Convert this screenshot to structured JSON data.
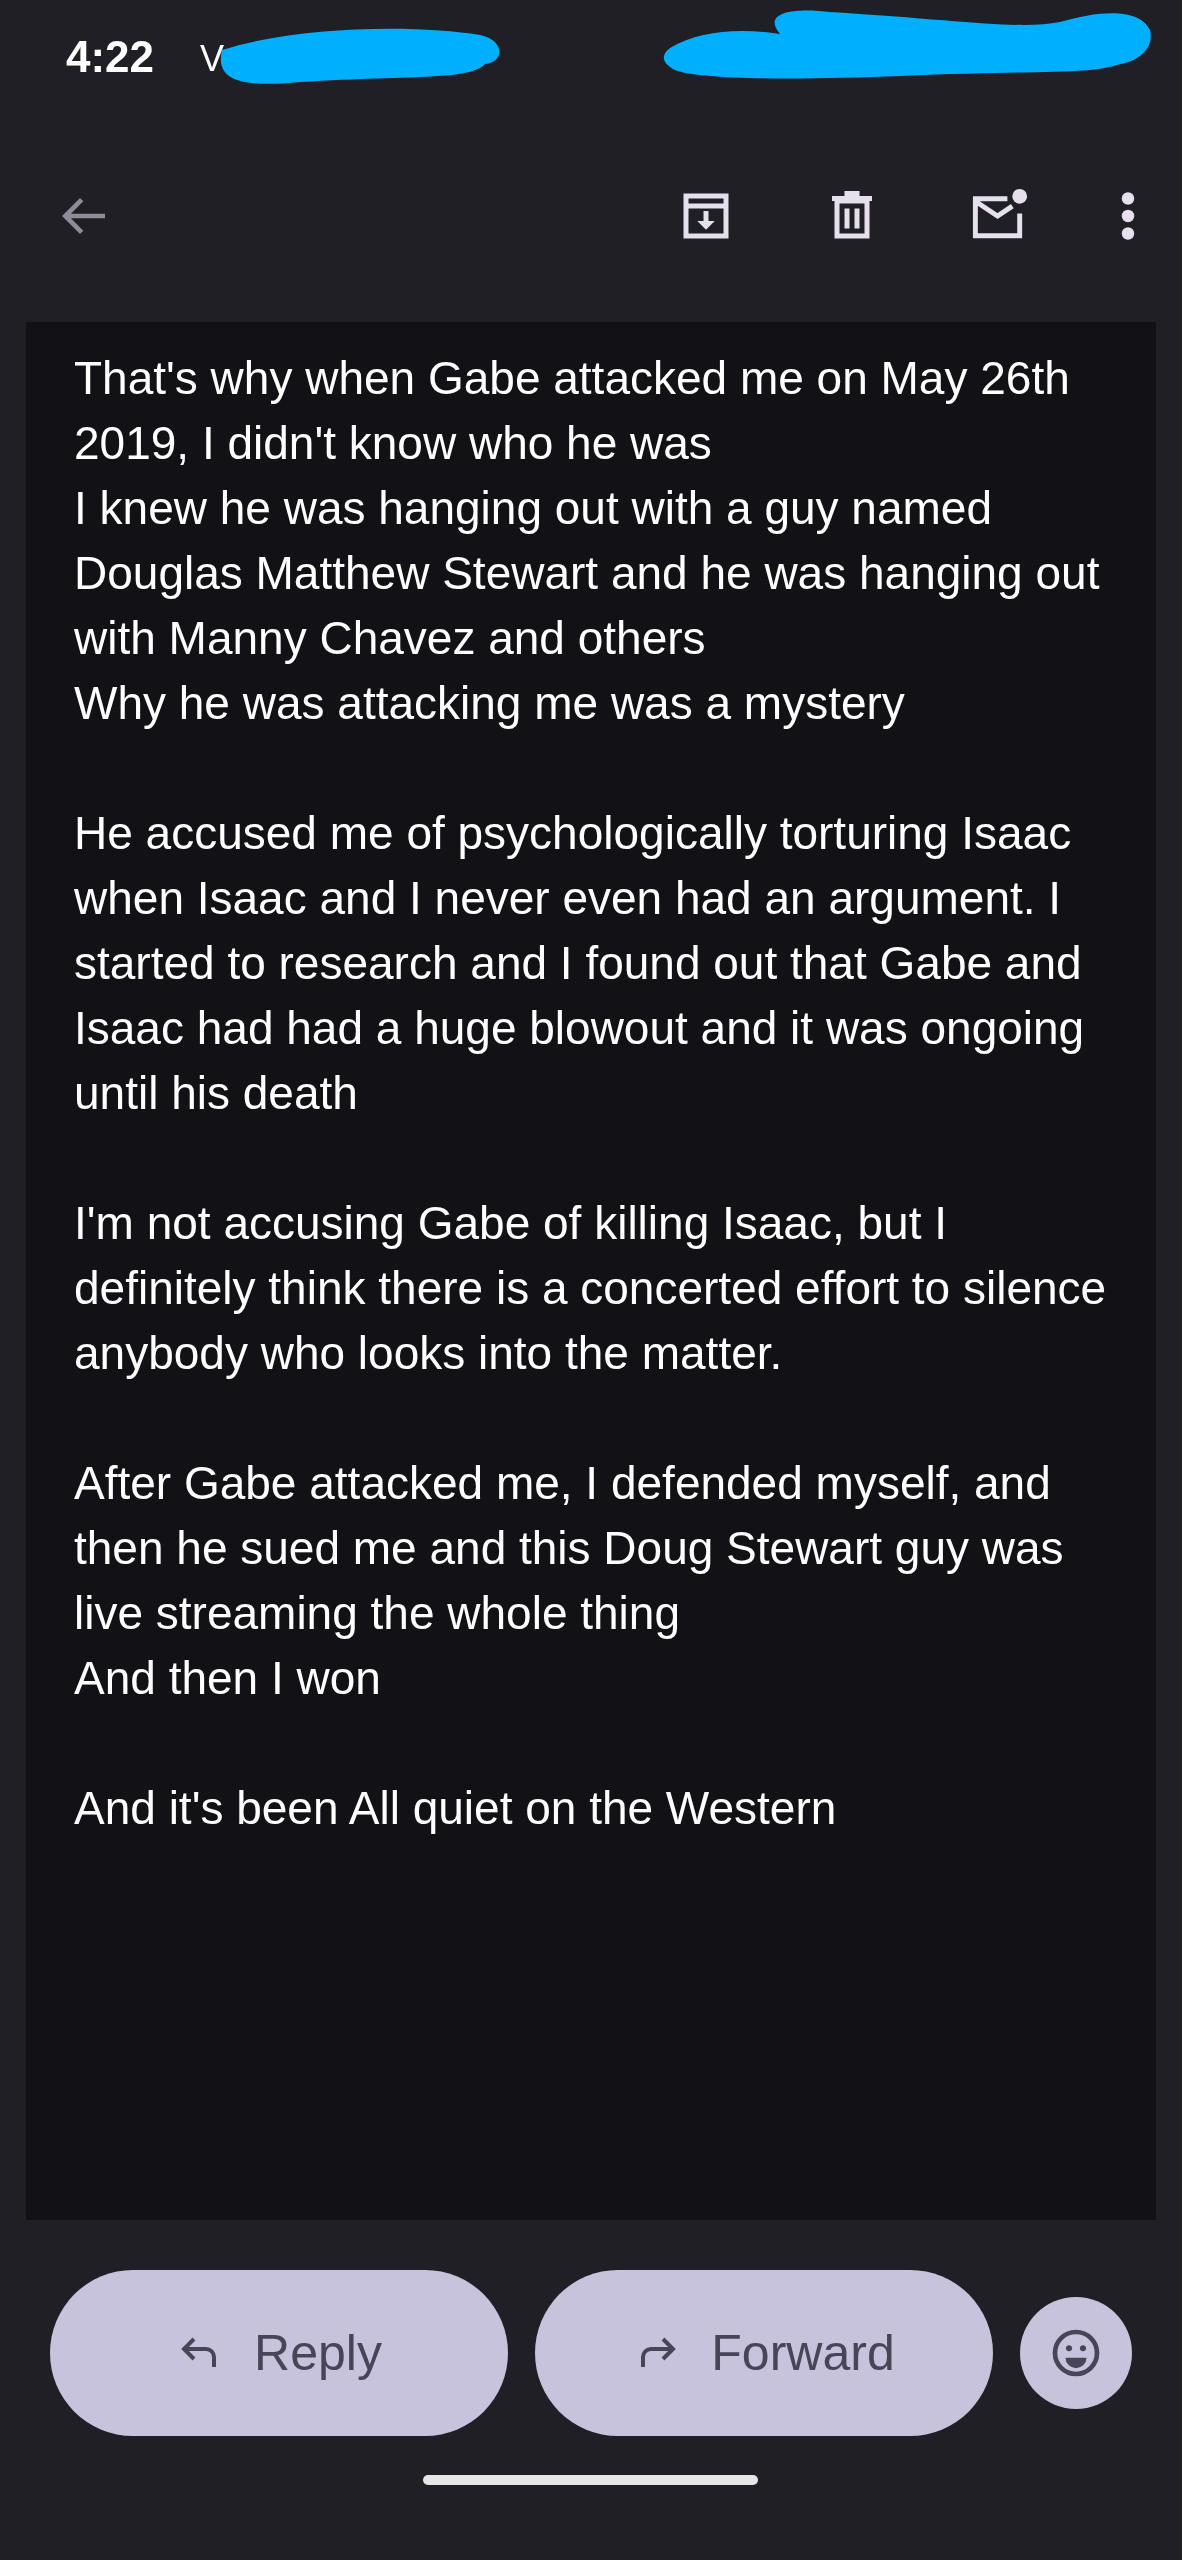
{
  "status_bar": {
    "time": "4:22",
    "carrier_fragment": "V"
  },
  "toolbar": {
    "actions": [
      {
        "kind": "archive"
      },
      {
        "kind": "delete"
      },
      {
        "kind": "mark_unread"
      },
      {
        "kind": "more"
      }
    ]
  },
  "message": {
    "paragraphs": [
      [
        "That's why when Gabe attacked me on May 26th 2019, I didn't know who he was",
        "I knew he was hanging out with a guy named Douglas Matthew Stewart and he was hanging out with Manny Chavez and others",
        "Why he was attacking me was a mystery"
      ],
      [
        "He accused me of psychologically torturing Isaac when Isaac and I never even had an argument. I started to research and I found out that Gabe and Isaac had had a huge blowout and it was ongoing until his death"
      ],
      [
        "I'm not accusing Gabe of killing Isaac, but I definitely think there is a concerted effort to silence anybody who looks into the matter."
      ],
      [
        "After Gabe attacked me, I defended myself, and then he sued me and this Doug Stewart guy was live streaming the whole thing",
        "And then I won"
      ],
      [
        "And it's been All quiet on the Western"
      ]
    ]
  },
  "actions": [
    {
      "kind": "reply",
      "label": "Reply"
    },
    {
      "kind": "forward",
      "label": "Forward"
    },
    {
      "kind": "emoji"
    }
  ]
}
